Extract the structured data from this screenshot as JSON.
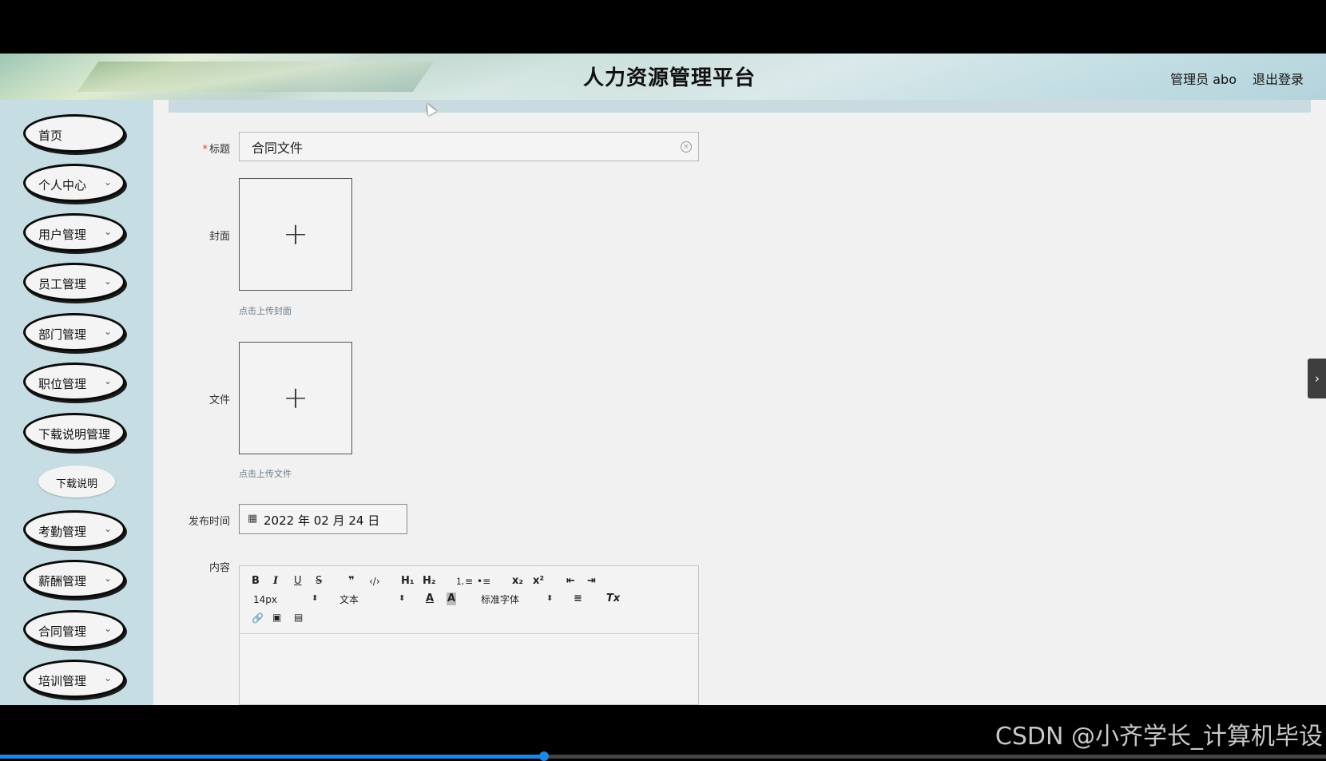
{
  "header": {
    "title": "人力资源管理平台",
    "user": "管理员 abo",
    "logout": "退出登录"
  },
  "sidebar": {
    "items": [
      {
        "label": "首页",
        "chevron": ""
      },
      {
        "label": "个人中心",
        "chevron": "⌄"
      },
      {
        "label": "用户管理",
        "chevron": "⌄"
      },
      {
        "label": "员工管理",
        "chevron": "⌄"
      },
      {
        "label": "部门管理",
        "chevron": "⌄"
      },
      {
        "label": "职位管理",
        "chevron": "⌄"
      },
      {
        "label": "下载说明管理",
        "chevron": ""
      },
      {
        "label": "考勤管理",
        "chevron": "⌄"
      },
      {
        "label": "薪酬管理",
        "chevron": "⌄"
      },
      {
        "label": "合同管理",
        "chevron": "⌄"
      },
      {
        "label": "培训管理",
        "chevron": "⌄"
      }
    ],
    "subitem": "下载说明"
  },
  "form": {
    "required_mark": "*",
    "title_label": "标题",
    "title_value": "合同文件",
    "clear_glyph": "×",
    "cover_label": "封面",
    "cover_plus": "+",
    "cover_tip": "点击上传封面",
    "file_label": "文件",
    "file_plus": "+",
    "file_tip": "点击上传文件",
    "date_label": "发布时间",
    "date_icon": "▦",
    "date_value": "2022 年 02 月 24 日",
    "content_label": "内容"
  },
  "editor": {
    "bold": "B",
    "italic": "I",
    "underline": "U",
    "strike": "S",
    "quote": "❞",
    "code": "‹/›",
    "h1": "H₁",
    "h2": "H₂",
    "ordered_list": "⒈≡",
    "bullet_list": "•≡",
    "subscript": "x₂",
    "superscript": "x²",
    "outdent": "⇤",
    "indent": "⇥",
    "size": "14px",
    "header_select": "文本",
    "font_color": "A",
    "background": "A",
    "font_select": "标准字体",
    "align": "≡",
    "clean": "Tx",
    "link": "🔗",
    "image": "▣",
    "video": "▤",
    "select_arrow": "⬍"
  },
  "right_handle": "›",
  "watermark": "CSDN @小齐学长_计算机毕设",
  "video_progress": 0.41
}
